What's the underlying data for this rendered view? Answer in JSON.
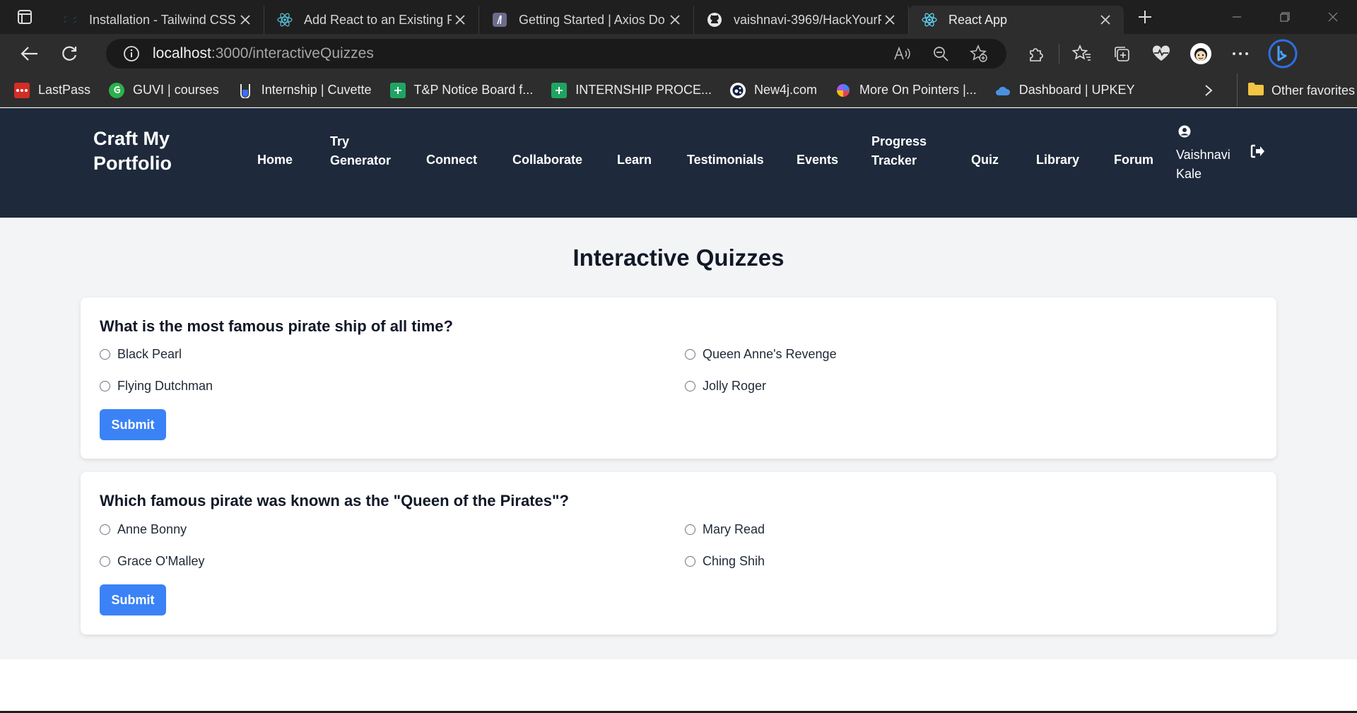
{
  "browser": {
    "tabs": [
      {
        "title": "Installation - Tailwind CSS",
        "icon": "tailwind-icon",
        "active": false
      },
      {
        "title": "Add React to an Existing P",
        "icon": "react-icon",
        "active": false
      },
      {
        "title": "Getting Started | Axios Do",
        "icon": "axios-icon",
        "active": false
      },
      {
        "title": "vaishnavi-3969/HackYourP",
        "icon": "github-icon",
        "active": false
      },
      {
        "title": "React App",
        "icon": "react-icon",
        "active": true
      }
    ],
    "url_host": "localhost",
    "url_path": ":3000/interactiveQuizzes",
    "bookmarks": [
      {
        "label": "LastPass",
        "icon": "lastpass-icon",
        "color": "#d32d27"
      },
      {
        "label": "GUVI | courses",
        "icon": "guvi-icon",
        "color": "#2bb24c"
      },
      {
        "label": "Internship | Cuvette",
        "icon": "cuvette-icon",
        "color": "#3a6ff7"
      },
      {
        "label": "T&P Notice Board f...",
        "icon": "sheets-icon",
        "color": "#1fa463"
      },
      {
        "label": "INTERNSHIP PROCE...",
        "icon": "sheets-icon",
        "color": "#1fa463"
      },
      {
        "label": "New4j.com",
        "icon": "neo4j-icon",
        "color": "#0b1d3a"
      },
      {
        "label": "More On Pointers |...",
        "icon": "pinwheel-icon",
        "color": "#e4405f"
      },
      {
        "label": "Dashboard | UPKEY",
        "icon": "upkey-icon",
        "color": "#4a90e2"
      }
    ],
    "other_favorites": "Other favorites"
  },
  "site": {
    "brand": "Craft My Portfolio",
    "nav": [
      {
        "label": "Home"
      },
      {
        "label": "Try Generator"
      },
      {
        "label": "Connect"
      },
      {
        "label": "Collaborate"
      },
      {
        "label": "Learn"
      },
      {
        "label": "Testimonials"
      },
      {
        "label": "Events"
      },
      {
        "label": "Progress Tracker"
      },
      {
        "label": "Quiz"
      },
      {
        "label": "Library"
      },
      {
        "label": "Forum"
      }
    ],
    "user_name": "Vaishnavi Kale"
  },
  "page": {
    "title": "Interactive Quizzes",
    "quizzes": [
      {
        "question": "What is the most famous pirate ship of all time?",
        "options": [
          "Black Pearl",
          "Queen Anne's Revenge",
          "Flying Dutchman",
          "Jolly Roger"
        ],
        "submit_label": "Submit"
      },
      {
        "question": "Which famous pirate was known as the \"Queen of the Pirates\"?",
        "options": [
          "Anne Bonny",
          "Mary Read",
          "Grace O'Malley",
          "Ching Shih"
        ],
        "submit_label": "Submit"
      }
    ]
  },
  "colors": {
    "navbar_bg": "#1e293b",
    "page_bg": "#f3f4f6",
    "submit_bg": "#3b82f6"
  }
}
